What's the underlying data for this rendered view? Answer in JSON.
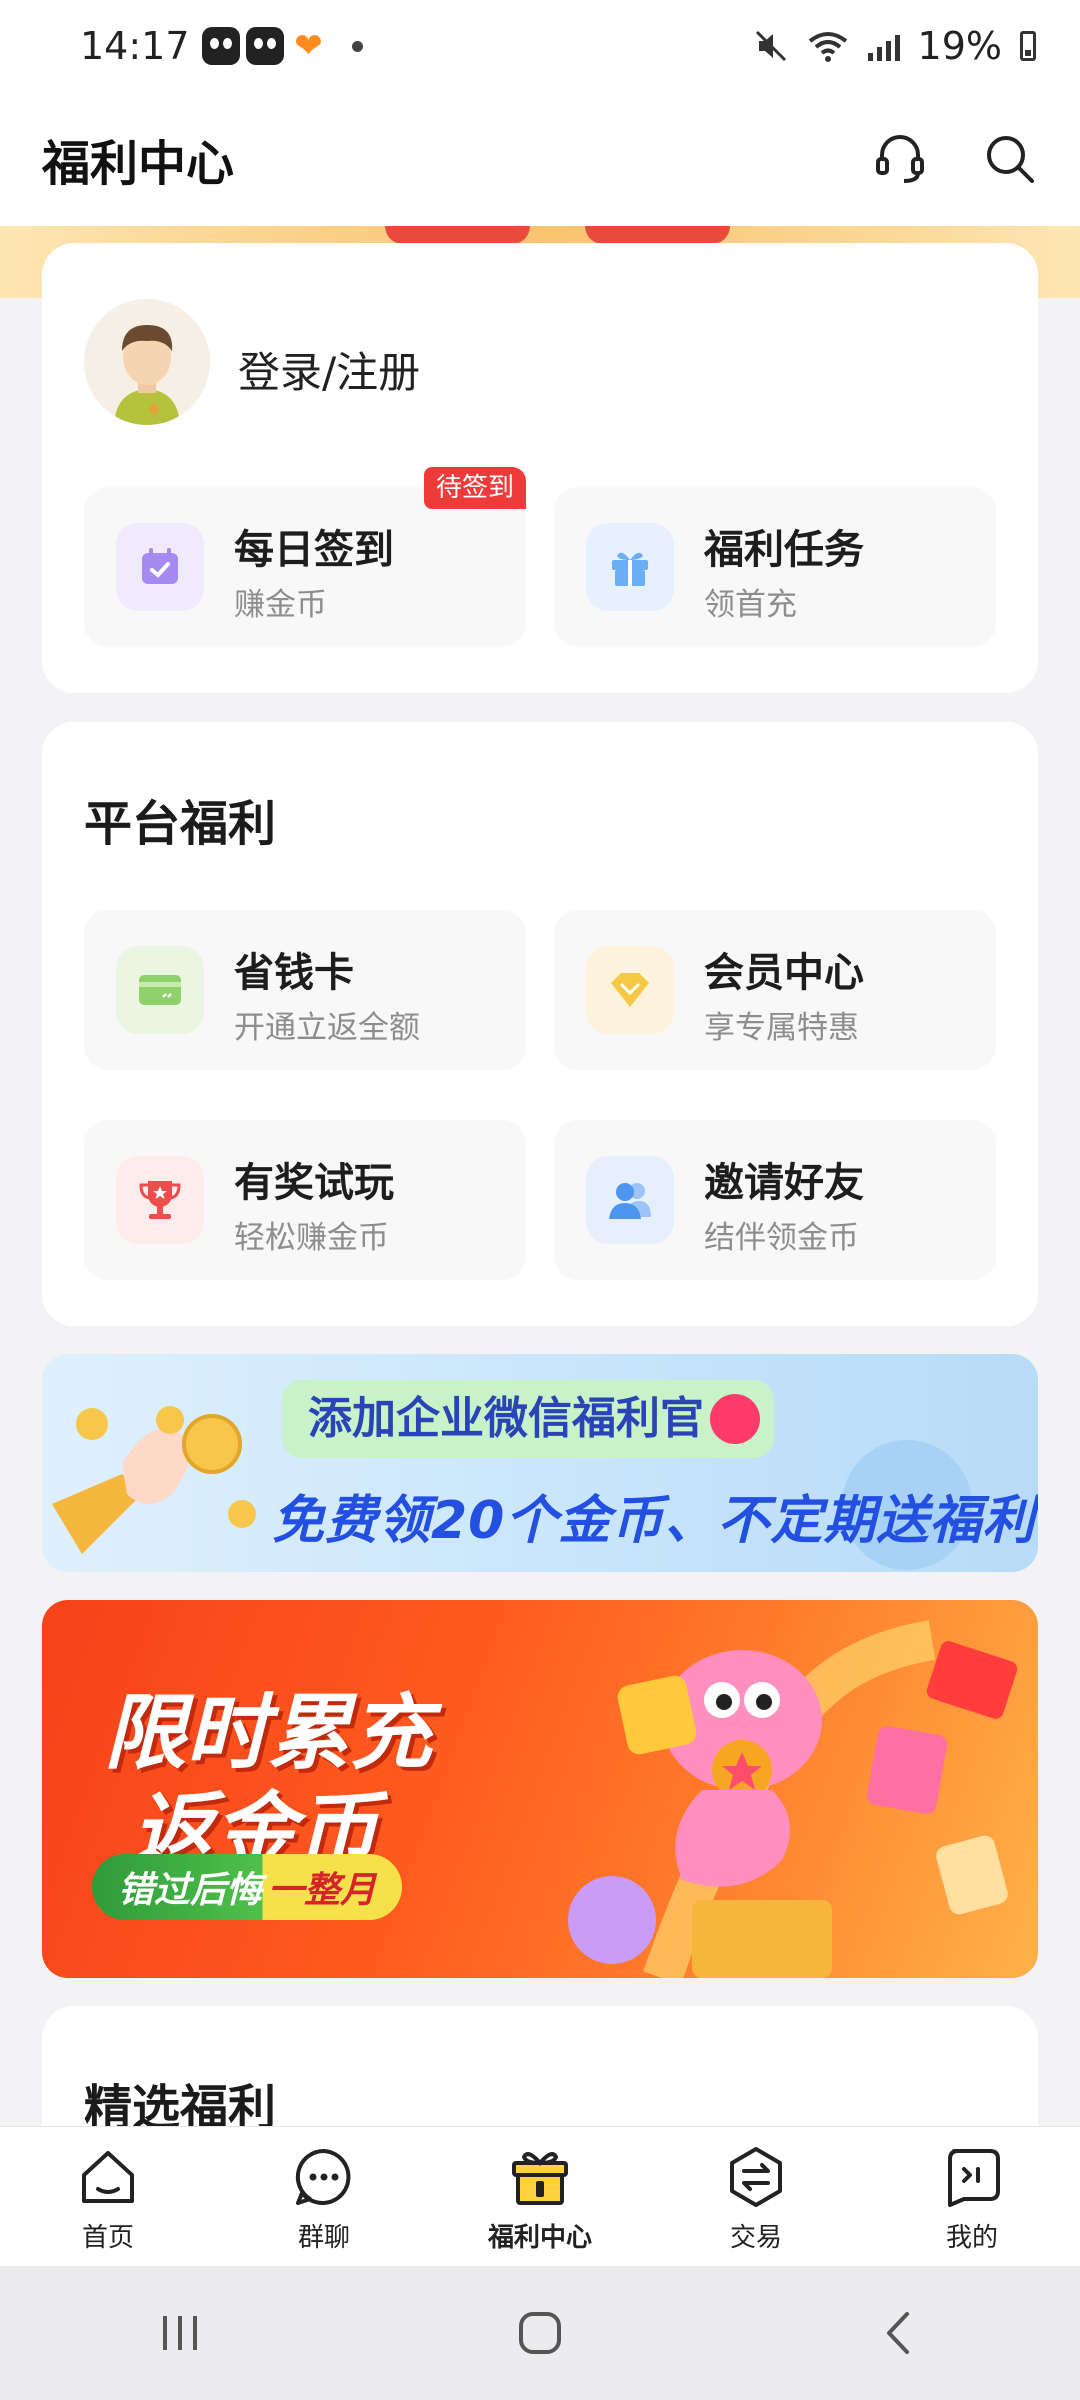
{
  "status_bar": {
    "time": "14:17",
    "battery": "19%"
  },
  "header": {
    "title": "福利中心"
  },
  "user_card": {
    "login_label": "登录/注册",
    "tiles": [
      {
        "title": "每日签到",
        "subtitle": "赚金币",
        "badge": "待签到",
        "icon": "calendar-check-icon",
        "color": "#9a7cf0"
      },
      {
        "title": "福利任务",
        "subtitle": "领首充",
        "icon": "gift-icon",
        "color": "#5aa3f3"
      }
    ]
  },
  "platform": {
    "title": "平台福利",
    "tiles": [
      {
        "title": "省钱卡",
        "subtitle": "开通立返全额",
        "icon": "card-icon",
        "color": "#8fd16b"
      },
      {
        "title": "会员中心",
        "subtitle": "享专属特惠",
        "icon": "diamond-icon",
        "color": "#f7c843"
      },
      {
        "title": "有奖试玩",
        "subtitle": "轻松赚金币",
        "icon": "trophy-icon",
        "color": "#ef4d4d"
      },
      {
        "title": "邀请好友",
        "subtitle": "结伴领金币",
        "icon": "friends-icon",
        "color": "#4d95f0"
      }
    ]
  },
  "wechat_banner": {
    "tag": "添加企业微信福利官",
    "main": "免费领20个金币、不定期送福利"
  },
  "promo_banner": {
    "line1": "限时累充",
    "line2": "返金币",
    "pill_a": "错过后悔",
    "pill_b": "一整月"
  },
  "featured": {
    "title": "精选福利"
  },
  "tabbar": {
    "items": [
      {
        "label": "首页",
        "icon": "home-icon"
      },
      {
        "label": "群聊",
        "icon": "chat-icon"
      },
      {
        "label": "福利中心",
        "icon": "gift-box-icon"
      },
      {
        "label": "交易",
        "icon": "exchange-icon"
      },
      {
        "label": "我的",
        "icon": "profile-icon"
      }
    ],
    "active_index": 2
  }
}
